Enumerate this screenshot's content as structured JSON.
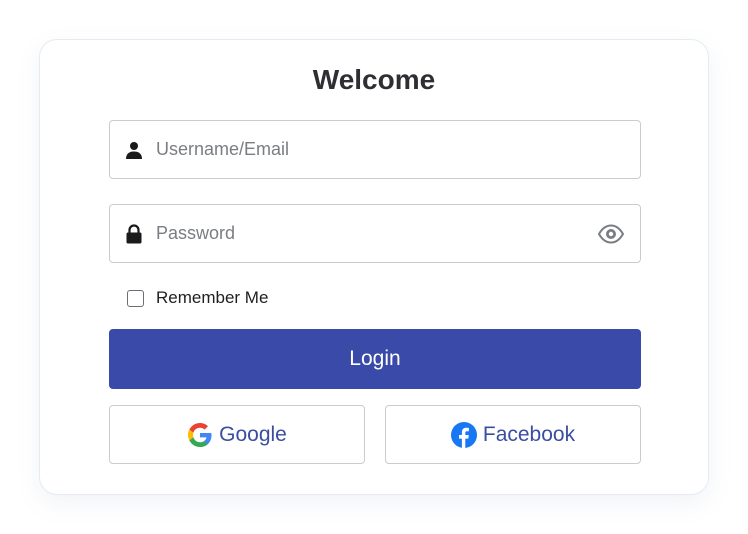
{
  "form": {
    "title": "Welcome",
    "username": {
      "placeholder": "Username/Email",
      "value": "",
      "icon": "user-icon"
    },
    "password": {
      "placeholder": "Password",
      "value": "",
      "icon": "lock-icon",
      "toggle_icon": "eye-icon"
    },
    "remember": {
      "label": "Remember Me",
      "checked": false
    },
    "login_label": "Login",
    "social": [
      {
        "label": "Google",
        "icon": "google-icon"
      },
      {
        "label": "Facebook",
        "icon": "facebook-icon"
      }
    ]
  },
  "colors": {
    "primary": "#3a4aa8",
    "social_text": "#3b4ea0",
    "border": "#c9ccd1",
    "title": "#2f2f33",
    "facebook": "#1877f2"
  }
}
